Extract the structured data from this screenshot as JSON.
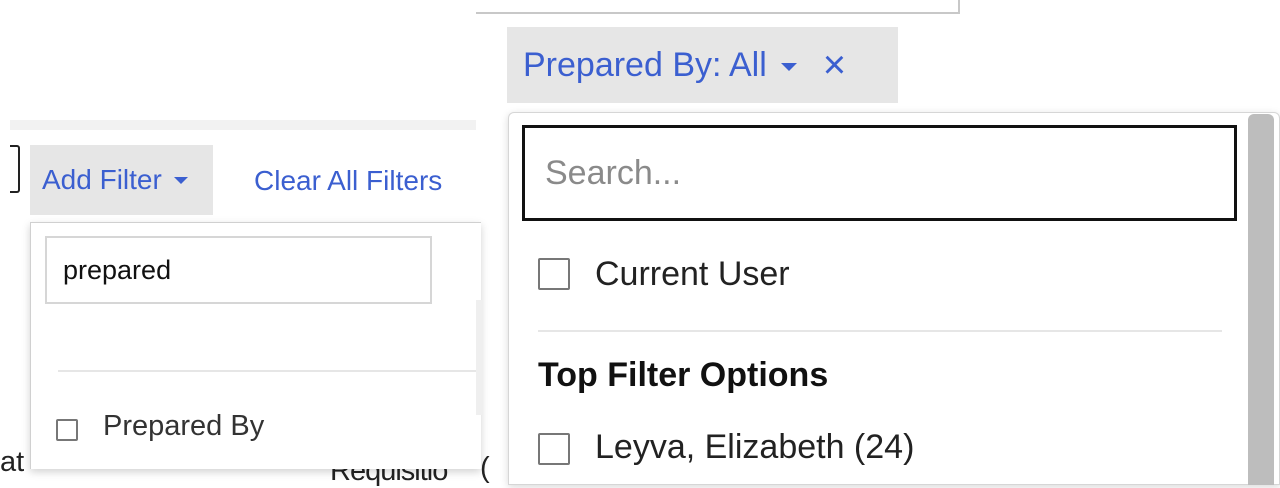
{
  "left_panel": {
    "add_filter_label": "Add Filter",
    "clear_all_label": "Clear All Filters",
    "search_value": "prepared",
    "option_label": "Prepared By",
    "background_fragment_left": "at",
    "background_fragment_mid": "Requisitio"
  },
  "right_panel": {
    "chip_label": "Prepared By: All",
    "close_icon": "×",
    "search_placeholder": "Search...",
    "current_user_label": "Current User",
    "section_heading": "Top Filter Options",
    "options": [
      {
        "label": "Leyva, Elizabeth (24)"
      }
    ],
    "background_fragment": "("
  },
  "colors": {
    "link": "#3b5fd0",
    "chip_bg": "#e6e6e6",
    "scrollbar": "#bdbdbd"
  }
}
